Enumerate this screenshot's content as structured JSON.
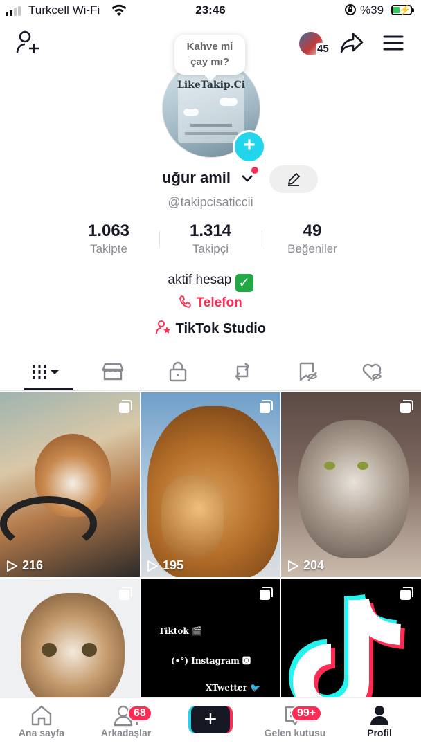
{
  "status_bar": {
    "carrier": "Turkcell Wi-Fi",
    "time": "23:46",
    "battery_percent": "%39",
    "battery_level": 0.39
  },
  "profile": {
    "bubble_line1": "Kahve mi",
    "bubble_line2": "çay mı?",
    "avatar_brand": "LikeTakip.Ci",
    "story_viewers_count": "45",
    "username": "uğur amil",
    "handle": "@takipcisaticcii",
    "stats": [
      {
        "value": "1.063",
        "label": "Takipte"
      },
      {
        "value": "1.314",
        "label": "Takipçi"
      },
      {
        "value": "49",
        "label": "Beğeniler"
      }
    ],
    "bio": "aktif hesap",
    "phone_label": "Telefon",
    "studio_label": "TikTok Studio"
  },
  "tabs": [
    "videos-grid",
    "shop",
    "private",
    "reposts",
    "favorites",
    "liked"
  ],
  "videos": [
    {
      "views": "216",
      "subject": "dog in car"
    },
    {
      "views": "195",
      "subject": "lion"
    },
    {
      "views": "204",
      "subject": "cat"
    },
    {
      "views": "",
      "subject": "kitten"
    },
    {
      "views": "",
      "subject": "social links",
      "lines": [
        "Tiktok 🎬",
        "(•°) Instagram 🅾",
        "XTwetter 🐦"
      ]
    },
    {
      "views": "",
      "subject": "tiktok logo"
    }
  ],
  "nav": {
    "home": "Ana sayfa",
    "friends": "Arkadaşlar",
    "friends_badge": "68",
    "inbox": "Gelen kutusu",
    "inbox_badge": "99+",
    "profile": "Profil"
  },
  "colors": {
    "accent": "#fe2c55",
    "cyan": "#20d5ec",
    "text": "#161823",
    "muted": "#8a8b91"
  }
}
